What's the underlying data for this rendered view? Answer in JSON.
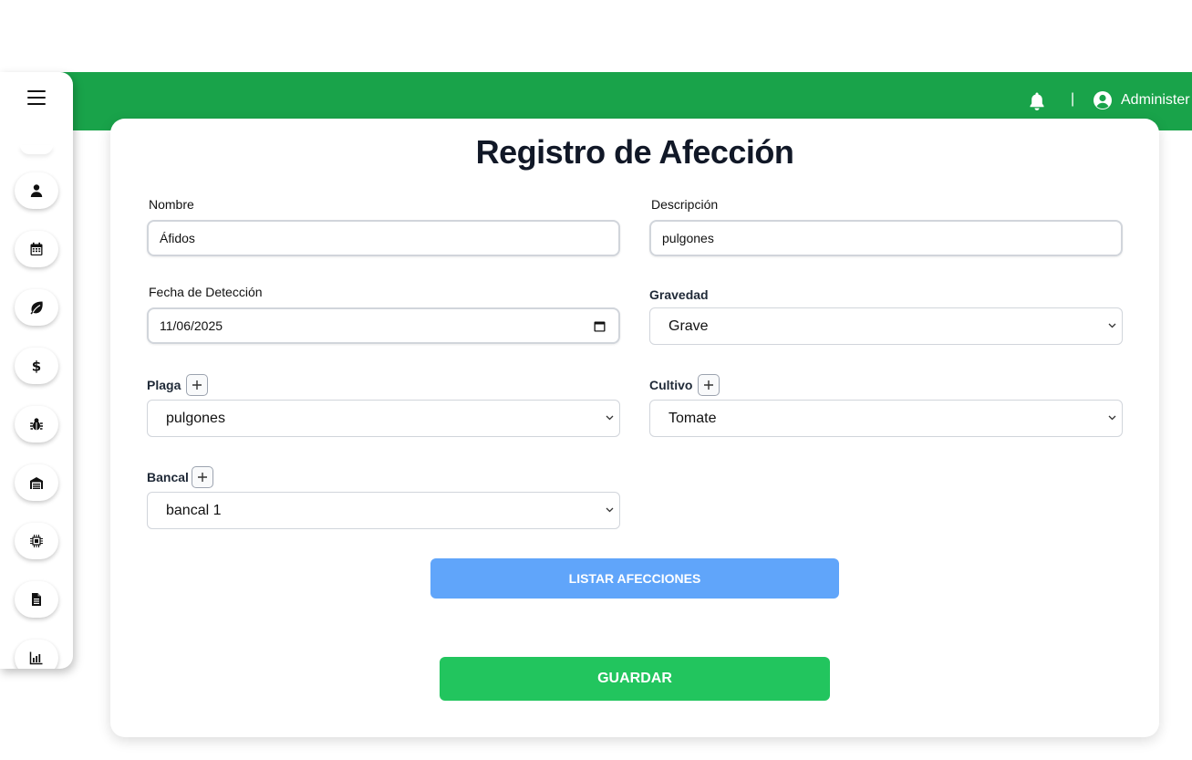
{
  "header": {
    "separator": "|",
    "user_name": "Administer",
    "bell_icon": "bell-icon",
    "user_icon": "user-circle-icon"
  },
  "sidebar": {
    "menu_icon": "hamburger-menu-icon",
    "items": [
      {
        "icon": "user-icon"
      },
      {
        "icon": "calendar-icon"
      },
      {
        "icon": "leaf-icon"
      },
      {
        "icon": "dollar-icon"
      },
      {
        "icon": "bug-icon"
      },
      {
        "icon": "warehouse-icon"
      },
      {
        "icon": "microchip-icon"
      },
      {
        "icon": "document-icon"
      },
      {
        "icon": "chart-icon"
      }
    ]
  },
  "form": {
    "title": "Registro de Afección",
    "nombre": {
      "label": "Nombre",
      "value": "Áfidos"
    },
    "descripcion": {
      "label": "Descripción",
      "value": "pulgones"
    },
    "fecha": {
      "label": "Fecha de Detección",
      "value": "11/06/2025"
    },
    "gravedad": {
      "label": "Gravedad",
      "value": "Grave"
    },
    "plaga": {
      "label": "Plaga",
      "value": "pulgones"
    },
    "cultivo": {
      "label": "Cultivo",
      "value": "Tomate"
    },
    "bancal": {
      "label": "Bancal",
      "value": "bancal 1"
    },
    "list_button": "LISTAR AFECCIONES",
    "save_button": "GUARDAR"
  },
  "colors": {
    "header_bg": "#19a34a",
    "list_button_bg": "#60a5fa",
    "save_button_bg": "#22c55e"
  }
}
